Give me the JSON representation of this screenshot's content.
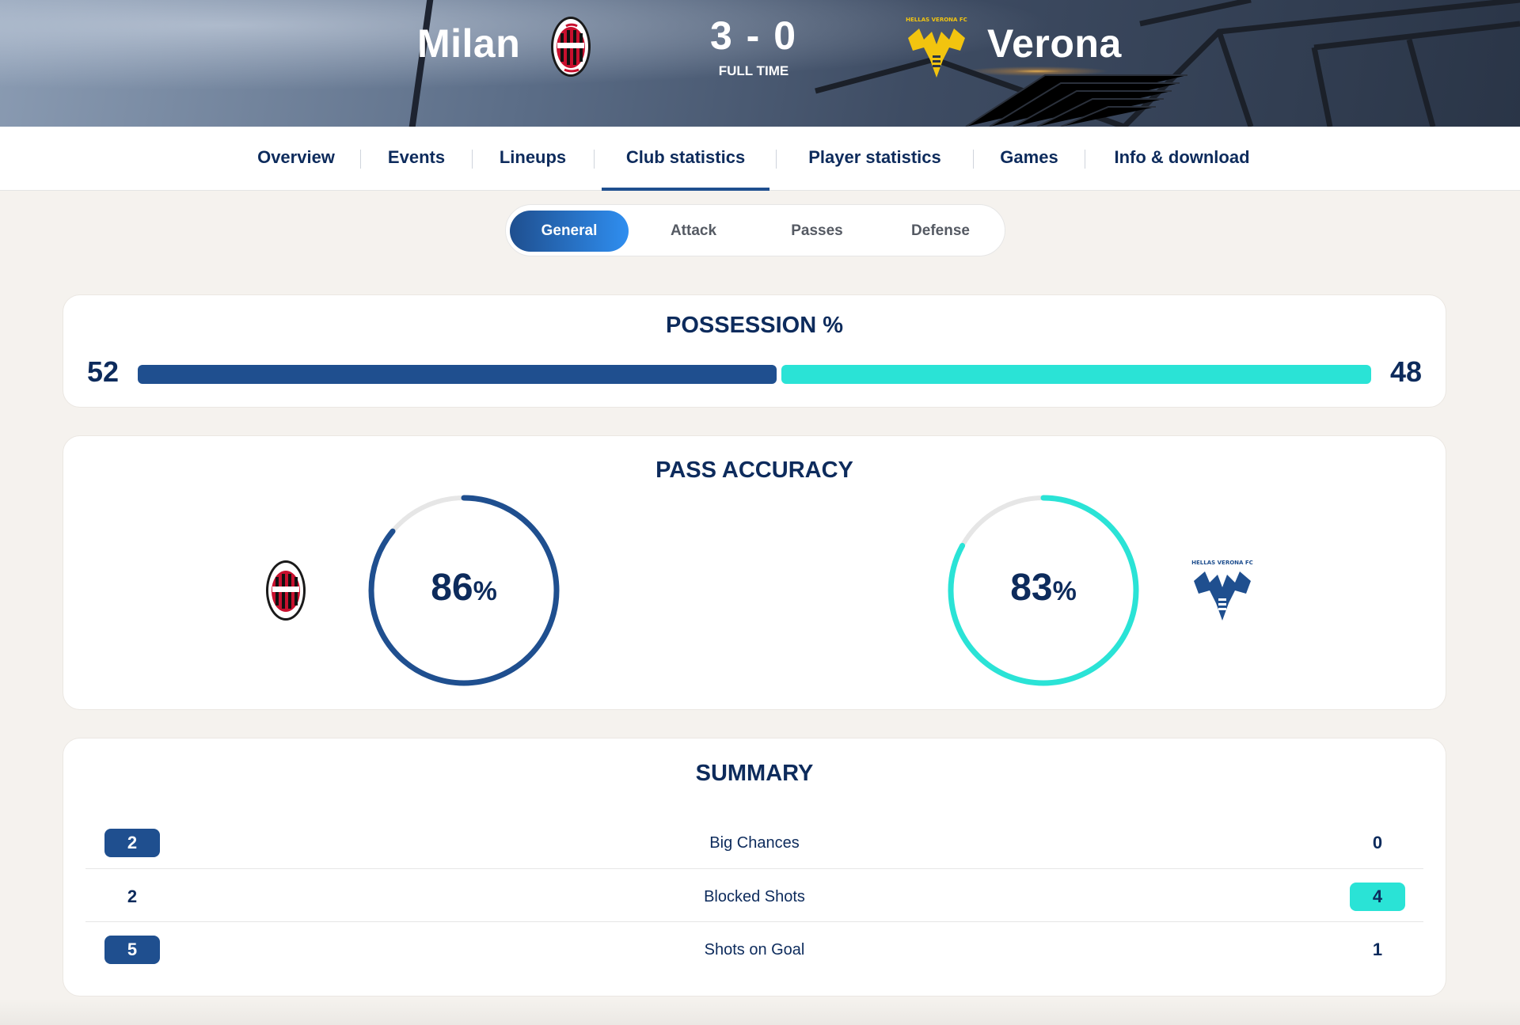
{
  "match": {
    "home_team": "Milan",
    "away_team": "Verona",
    "score": "3 - 0",
    "status": "FULL TIME",
    "home_crest_text": "ACM 1899",
    "away_crest_text": "HELLAS VERONA FC"
  },
  "tabs": [
    {
      "label": "Overview",
      "active": false
    },
    {
      "label": "Events",
      "active": false
    },
    {
      "label": "Lineups",
      "active": false
    },
    {
      "label": "Club statistics",
      "active": true
    },
    {
      "label": "Player statistics",
      "active": false
    },
    {
      "label": "Games",
      "active": false
    },
    {
      "label": "Info & download",
      "active": false
    }
  ],
  "segments": [
    {
      "label": "General",
      "active": true
    },
    {
      "label": "Attack",
      "active": false
    },
    {
      "label": "Passes",
      "active": false
    },
    {
      "label": "Defense",
      "active": false
    }
  ],
  "possession": {
    "title": "POSSESSION %",
    "home": "52",
    "away": "48"
  },
  "pass_accuracy": {
    "title": "PASS ACCURACY",
    "home_value": "86",
    "away_value": "83",
    "unit": "%"
  },
  "summary": {
    "title": "SUMMARY",
    "rows": [
      {
        "label": "Big Chances",
        "home": "2",
        "away": "0",
        "leader": "home"
      },
      {
        "label": "Blocked Shots",
        "home": "2",
        "away": "4",
        "leader": "away"
      },
      {
        "label": "Shots on Goal",
        "home": "5",
        "away": "1",
        "leader": "home"
      }
    ]
  },
  "colors": {
    "home": "#1f4f8f",
    "away": "#2ae3d6",
    "track": "#e6e6e6",
    "text": "#0d2b5c"
  }
}
